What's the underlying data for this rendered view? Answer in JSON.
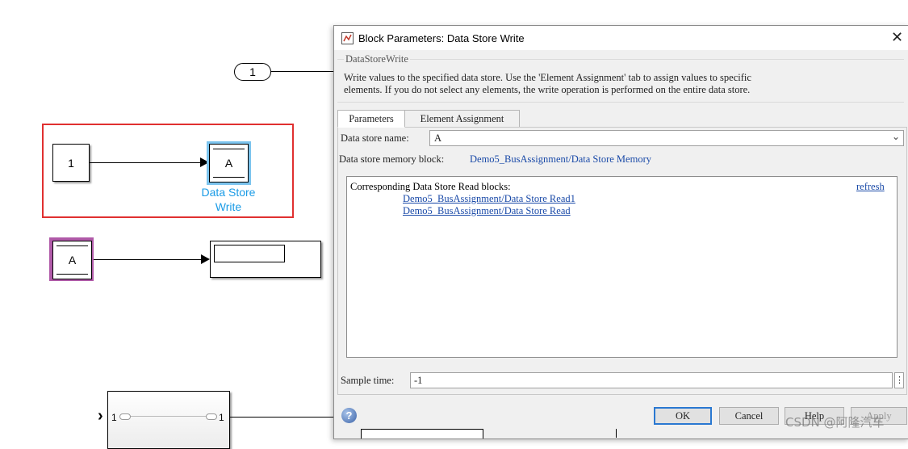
{
  "canvas": {
    "inport_label": "1",
    "constant_label": "1",
    "data_store_write_symbol": "A",
    "data_store_write_name": "Data Store Write",
    "data_store_read_symbol": "A",
    "bus_port_left": "1",
    "bus_port_right": "1",
    "colors": {
      "selection_red": "#e03030",
      "selected_blue": "#1a9be6",
      "read_purple": "#b05aa8"
    }
  },
  "dialog": {
    "title": "Block Parameters: Data Store Write",
    "section_label": "DataStoreWrite",
    "description_line1": "Write values to the specified data store. Use the 'Element Assignment' tab to assign values to specific",
    "description_line2": "elements. If you do not select any elements, the write operation is performed on the entire data store.",
    "tabs": [
      "Parameters",
      "Element Assignment"
    ],
    "data_store_name_label": "Data store name:",
    "data_store_name_value": "A",
    "memory_block_label": "Data store memory block:",
    "memory_block_link": "Demo5_BusAssignment/Data Store Memory",
    "corresponding_header": "Corresponding Data Store Read blocks:",
    "refresh_label": "refresh",
    "read_blocks": [
      "Demo5_BusAssignment/Data Store Read1",
      "Demo5_BusAssignment/Data Store Read"
    ],
    "sample_time_label": "Sample time:",
    "sample_time_value": "-1",
    "buttons": {
      "ok": "OK",
      "cancel": "Cancel",
      "help": "Help",
      "apply": "Apply"
    }
  },
  "watermark": "CSDN @阿隆汽车"
}
